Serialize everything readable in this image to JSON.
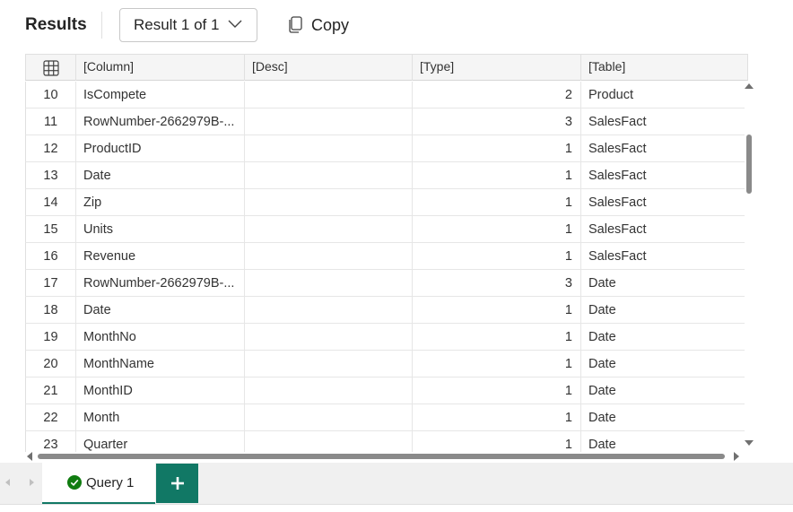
{
  "header": {
    "title": "Results",
    "result_selector": "Result 1 of 1",
    "copy_label": "Copy"
  },
  "grid": {
    "columns": [
      "[Column]",
      "[Desc]",
      "[Type]",
      "[Table]"
    ],
    "rows": [
      {
        "num": "10",
        "column": "IsCompete",
        "desc": "",
        "type": "2",
        "table": "Product"
      },
      {
        "num": "11",
        "column": "RowNumber-2662979B-...",
        "desc": "",
        "type": "3",
        "table": "SalesFact"
      },
      {
        "num": "12",
        "column": "ProductID",
        "desc": "",
        "type": "1",
        "table": "SalesFact"
      },
      {
        "num": "13",
        "column": "Date",
        "desc": "",
        "type": "1",
        "table": "SalesFact"
      },
      {
        "num": "14",
        "column": "Zip",
        "desc": "",
        "type": "1",
        "table": "SalesFact"
      },
      {
        "num": "15",
        "column": "Units",
        "desc": "",
        "type": "1",
        "table": "SalesFact"
      },
      {
        "num": "16",
        "column": "Revenue",
        "desc": "",
        "type": "1",
        "table": "SalesFact"
      },
      {
        "num": "17",
        "column": "RowNumber-2662979B-...",
        "desc": "",
        "type": "3",
        "table": "Date"
      },
      {
        "num": "18",
        "column": "Date",
        "desc": "",
        "type": "1",
        "table": "Date"
      },
      {
        "num": "19",
        "column": "MonthNo",
        "desc": "",
        "type": "1",
        "table": "Date"
      },
      {
        "num": "20",
        "column": "MonthName",
        "desc": "",
        "type": "1",
        "table": "Date"
      },
      {
        "num": "21",
        "column": "MonthID",
        "desc": "",
        "type": "1",
        "table": "Date"
      },
      {
        "num": "22",
        "column": "Month",
        "desc": "",
        "type": "1",
        "table": "Date"
      },
      {
        "num": "23",
        "column": "Quarter",
        "desc": "",
        "type": "1",
        "table": "Date"
      }
    ]
  },
  "tabs": {
    "query_tab_label": "Query 1",
    "query_status": "success"
  },
  "colors": {
    "accent": "#117865",
    "success": "#107c10"
  }
}
